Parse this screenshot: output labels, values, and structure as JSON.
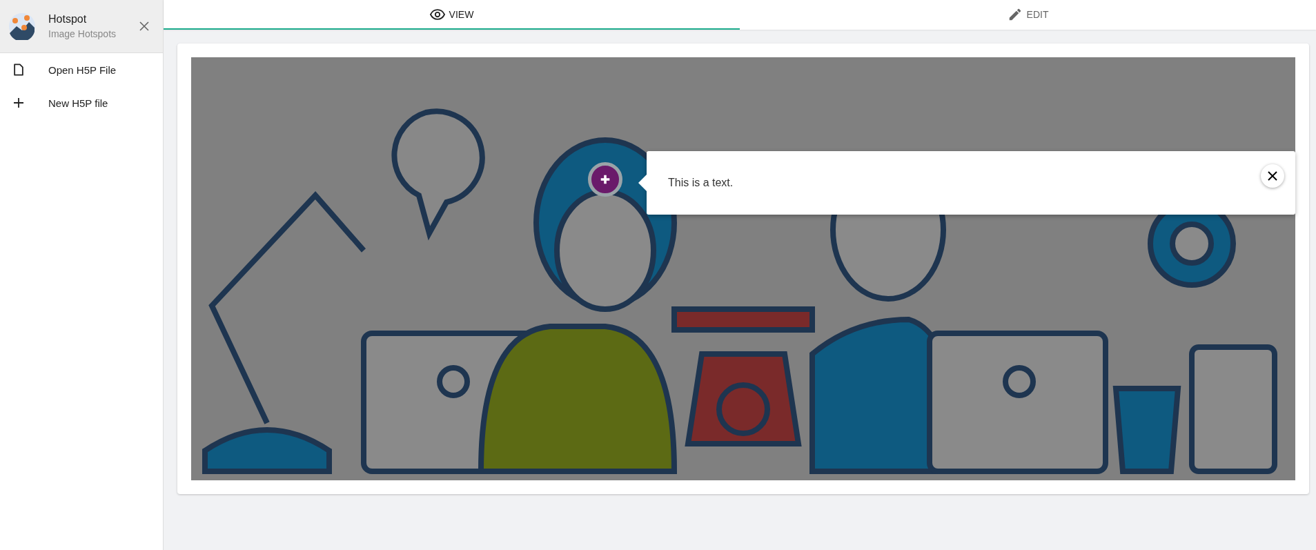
{
  "sidebar": {
    "header": {
      "title": "Hotspot",
      "subtitle": "Image Hotspots"
    },
    "items": [
      {
        "kind": "file",
        "label": "Open H5P File"
      },
      {
        "kind": "plus",
        "label": "New H5P file"
      }
    ]
  },
  "tabs": [
    {
      "kind": "eye",
      "label": "VIEW",
      "selected": true
    },
    {
      "kind": "pencil",
      "label": "EDIT",
      "selected": false
    }
  ],
  "hotspot": {
    "expanded": true,
    "popup_text": "This is a text."
  }
}
